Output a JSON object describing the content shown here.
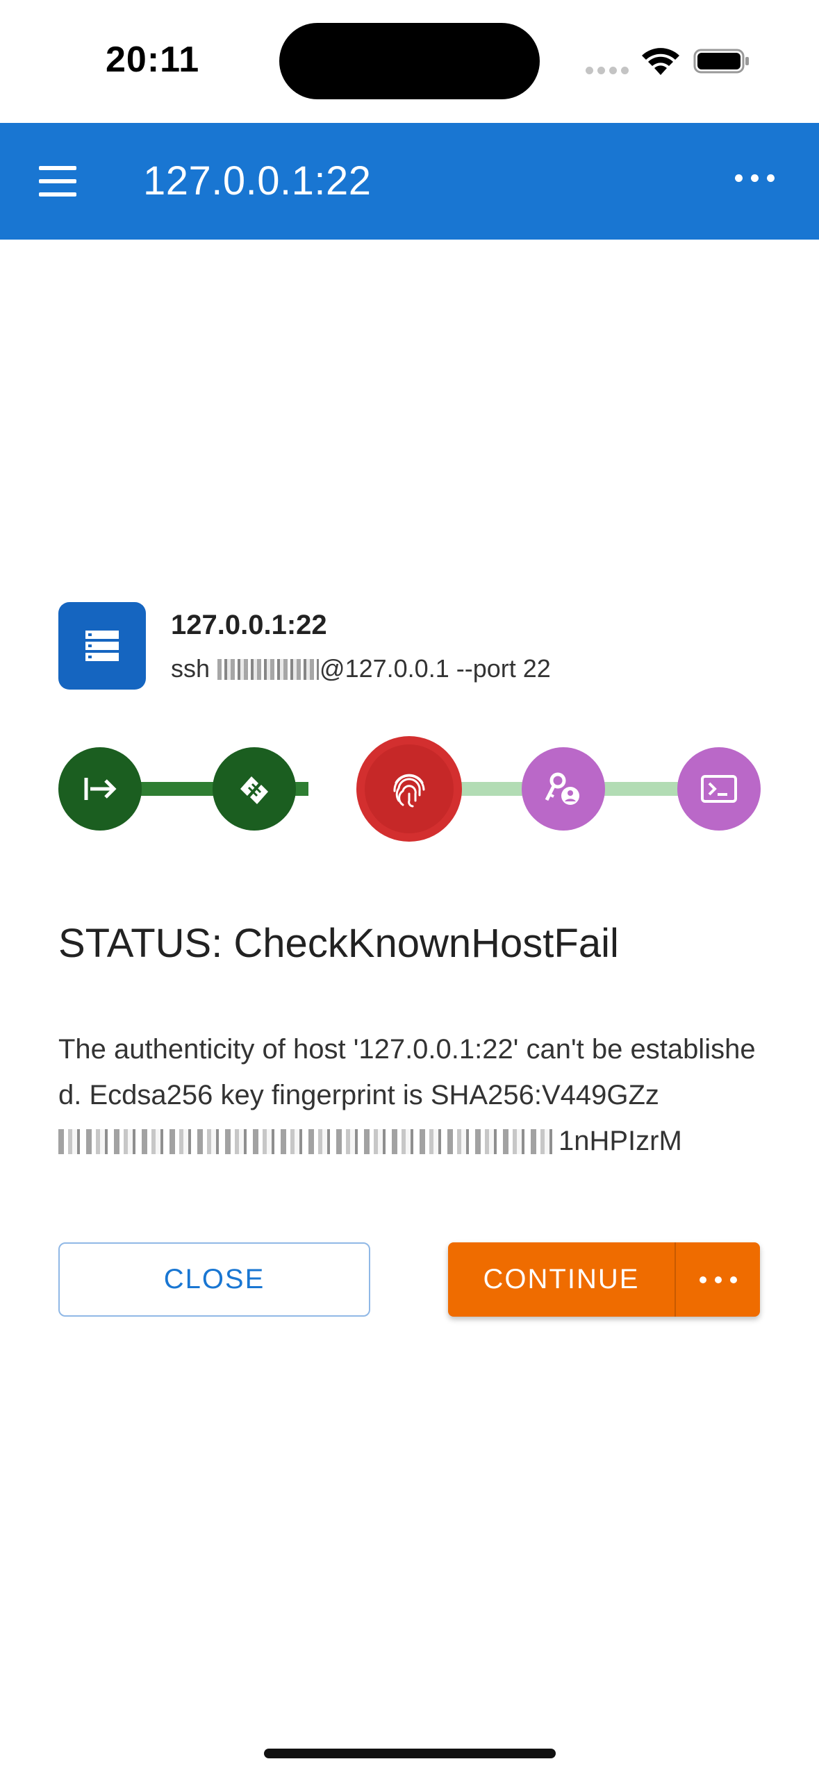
{
  "status_bar": {
    "time": "20:11"
  },
  "app_bar": {
    "title": "127.0.0.1:22",
    "menu_icon": "hamburger-menu-icon",
    "more_icon": "more-horizontal-icon",
    "color": "#1976d2"
  },
  "host": {
    "name": "127.0.0.1:22",
    "command_prefix": "ssh",
    "command_suffix": "@127.0.0.1 --port 22",
    "icon": "server-icon",
    "icon_color": "#1565c0"
  },
  "steps": [
    {
      "name": "connect",
      "icon": "login-arrow-icon",
      "state": "done",
      "color": "#1b5e20"
    },
    {
      "name": "handshake",
      "icon": "handshake-icon",
      "state": "done",
      "color": "#1b5e20"
    },
    {
      "name": "known-host",
      "icon": "fingerprint-icon",
      "state": "failed",
      "color": "#d32f2f"
    },
    {
      "name": "auth",
      "icon": "key-user-icon",
      "state": "pending",
      "color": "#ba68c8"
    },
    {
      "name": "terminal",
      "icon": "terminal-icon",
      "state": "pending",
      "color": "#ba68c8"
    }
  ],
  "status": {
    "title": "STATUS: CheckKnownHostFail",
    "message_part1": "The authenticity of host '127.0.0.1:22' can't be established. Ecdsa256 key fingerprint is SHA256:V449GZz",
    "message_part2": "1nHPIzrM"
  },
  "buttons": {
    "close_label": "CLOSE",
    "continue_label": "CONTINUE",
    "continue_color": "#ef6c00"
  }
}
